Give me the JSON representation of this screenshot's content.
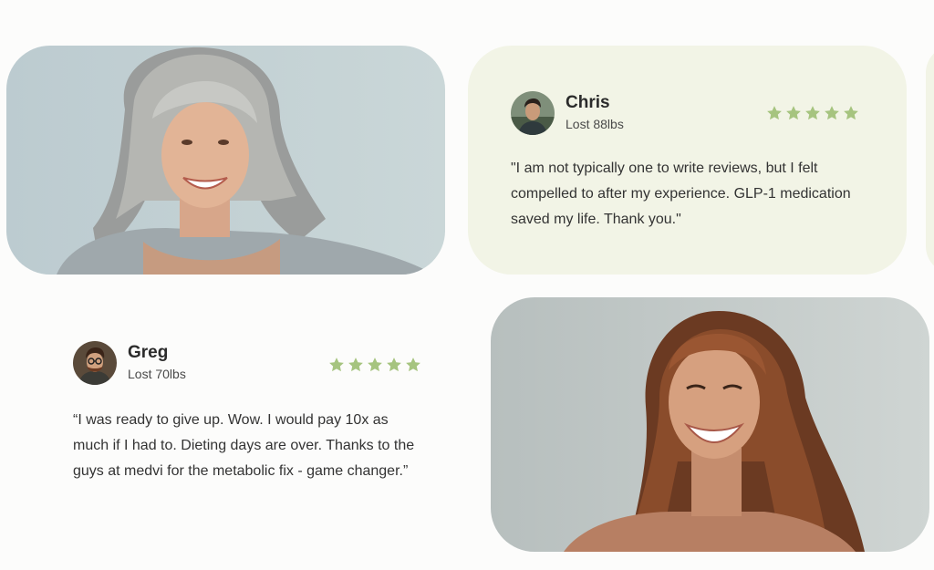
{
  "testimonials": [
    {
      "name": "Chris",
      "result": "Lost 88lbs",
      "rating": 5,
      "quote": "\"I am not typically one to write reviews, but I felt compelled to after my experience. GLP-1 medication saved my life. Thank you.\""
    },
    {
      "name": "Greg",
      "result": "Lost 70lbs",
      "rating": 5,
      "quote": "“I was ready to give up. Wow. I would pay 10x as much if I had to. Dieting days are over. Thanks to the guys at medvi for the metabolic fix - game changer.”"
    }
  ],
  "colors": {
    "star": "#a6c47f",
    "card_tint": "#f2f4e6",
    "photo_bg_1": "#c6d4d6",
    "photo_bg_2": "#c3cbca"
  },
  "icons": {
    "rating": "star-icon"
  }
}
